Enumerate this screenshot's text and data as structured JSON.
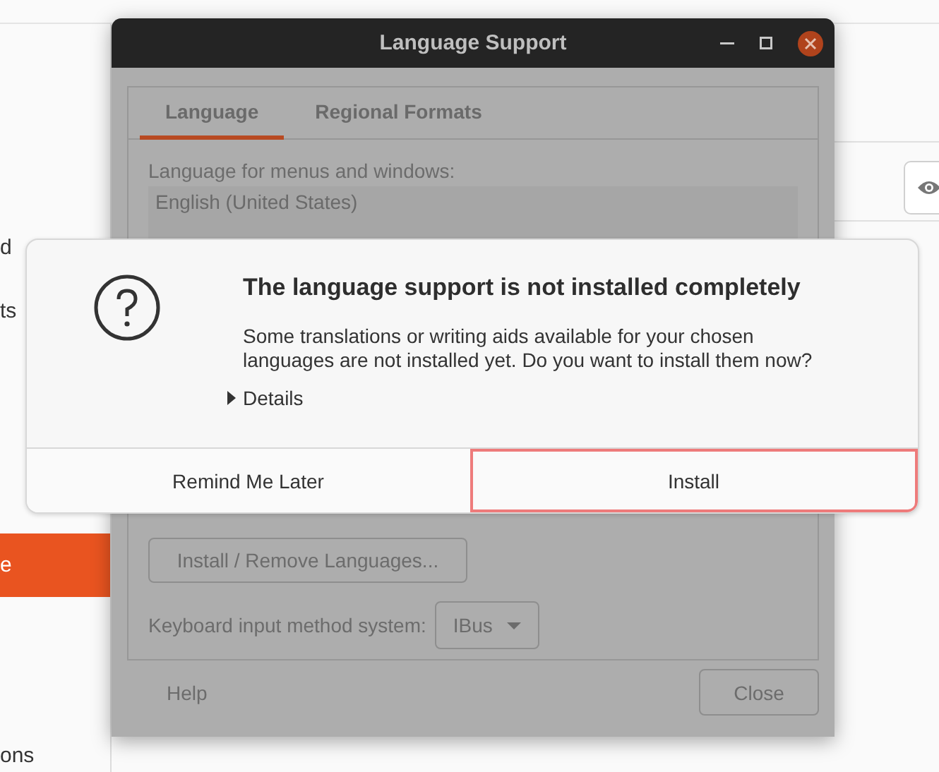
{
  "background_app": {
    "sidebar_items": [
      {
        "label": "d",
        "selected": false
      },
      {
        "label": "ts",
        "selected": false
      },
      {
        "label": "e",
        "selected": true
      },
      {
        "label": "ons",
        "selected": false
      }
    ]
  },
  "window": {
    "title": "Language Support",
    "tabs": [
      {
        "label": "Language",
        "selected": true
      },
      {
        "label": "Regional Formats",
        "selected": false
      }
    ],
    "language_label": "Language for menus and windows:",
    "languages": [
      "English (United States)"
    ],
    "install_remove_button": "Install / Remove Languages...",
    "input_method_label": "Keyboard input method system:",
    "input_method_value": "IBus",
    "help_button": "Help",
    "close_button": "Close"
  },
  "dialog": {
    "title": "The language support is not installed completely",
    "message": "Some translations or writing aids available for your chosen languages are not installed yet. Do you want to install them now?",
    "details": {
      "label": "Details",
      "expanded": false
    },
    "buttons": [
      {
        "label": "Remind Me Later",
        "focused": false
      },
      {
        "label": "Install",
        "focused": true
      }
    ]
  }
}
